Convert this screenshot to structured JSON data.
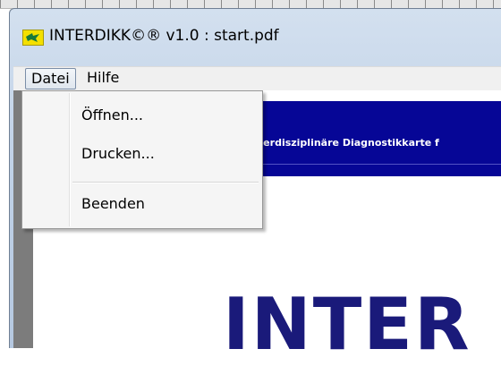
{
  "window": {
    "title": "INTERDIKK©® v1.0 : start.pdf",
    "icon": "app-logo-icon"
  },
  "menubar": {
    "items": [
      {
        "label": "Datei"
      },
      {
        "label": "Hilfe"
      }
    ]
  },
  "dropdown": {
    "items": [
      {
        "label": "Öffnen..."
      },
      {
        "label": "Drucken..."
      },
      {
        "label": "Beenden"
      }
    ]
  },
  "document": {
    "banner_text": "Interdisziplinäre Diagnostikkarte f",
    "big_word": "INTER"
  },
  "colors": {
    "banner_bg": "#060696",
    "big_word": "#1a1a7a",
    "menu_bg": "#f0f0f0",
    "title_bar": "#c2d3e8"
  }
}
